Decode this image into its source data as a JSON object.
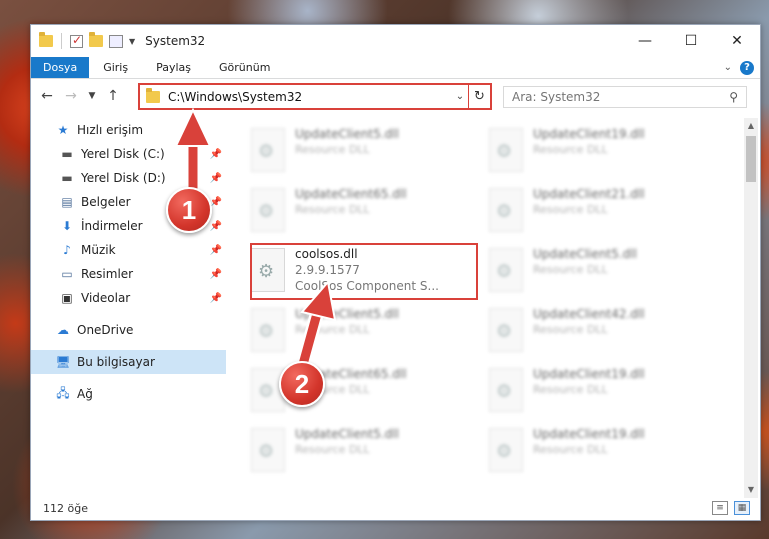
{
  "window": {
    "title": "System32"
  },
  "ribbon": {
    "tabs": [
      {
        "label": "Dosya",
        "active": true
      },
      {
        "label": "Giriş",
        "active": false
      },
      {
        "label": "Paylaş",
        "active": false
      },
      {
        "label": "Görünüm",
        "active": false
      }
    ]
  },
  "address": {
    "path": "C:\\Windows\\System32"
  },
  "search": {
    "placeholder": "Ara: System32"
  },
  "sidebar": {
    "items": [
      {
        "label": "Hızlı erişim",
        "icon": "star-icon"
      },
      {
        "label": "Yerel Disk (C:)",
        "icon": "drive-icon"
      },
      {
        "label": "Yerel Disk (D:)",
        "icon": "drive-icon"
      },
      {
        "label": "Belgeler",
        "icon": "documents-icon"
      },
      {
        "label": "İndirmeler",
        "icon": "download-icon"
      },
      {
        "label": "Müzik",
        "icon": "music-icon"
      },
      {
        "label": "Resimler",
        "icon": "pictures-icon"
      },
      {
        "label": "Videolar",
        "icon": "video-icon"
      },
      {
        "label": "OneDrive",
        "icon": "cloud-icon"
      },
      {
        "label": "Bu bilgisayar",
        "icon": "computer-icon"
      },
      {
        "label": "Ağ",
        "icon": "network-icon"
      }
    ]
  },
  "files": {
    "left": [
      {
        "name": "UpdateClient5.dll",
        "type": "Resource DLL"
      },
      {
        "name": "UpdateClient65.dll",
        "type": "Resource DLL"
      },
      {
        "name": "UpdateClient5.dll",
        "type": "Resource DLL"
      },
      {
        "name": "UpdateClient65.dll",
        "type": "Resource DLL"
      },
      {
        "name": "UpdateClient5.dll",
        "type": "Resource DLL"
      }
    ],
    "right": [
      {
        "name": "UpdateClient19.dll",
        "type": "Resource DLL"
      },
      {
        "name": "UpdateClient21.dll",
        "type": "Resource DLL"
      },
      {
        "name": "UpdateClient5.dll",
        "type": "Resource DLL"
      },
      {
        "name": "UpdateClient42.dll",
        "type": "Resource DLL"
      },
      {
        "name": "UpdateClient19.dll",
        "type": "Resource DLL"
      },
      {
        "name": "UpdateClient19.dll",
        "type": "Resource DLL"
      }
    ],
    "focus": {
      "name": "coolsos.dll",
      "version": "2.9.9.1577",
      "description": "CoolSos Component S..."
    }
  },
  "status": {
    "count": "112 öğe"
  },
  "callouts": {
    "one": "1",
    "two": "2"
  },
  "colors": {
    "accent": "#1979ca",
    "highlight": "#d9413a"
  }
}
